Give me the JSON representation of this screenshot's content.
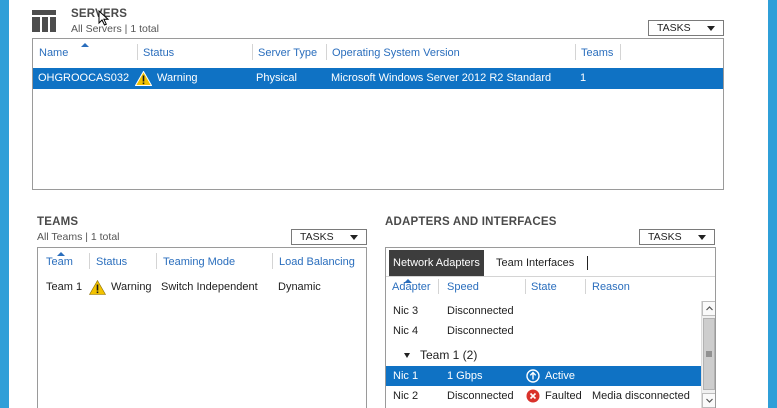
{
  "servers": {
    "title": "SERVERS",
    "subtitle": "All Servers | 1 total",
    "tasks_label": "TASKS",
    "columns": [
      "Name",
      "Status",
      "Server Type",
      "Operating System Version",
      "Teams"
    ],
    "rows": [
      {
        "name": "OHGROOCAS032",
        "status": "Warning",
        "server_type": "Physical",
        "os": "Microsoft Windows Server 2012 R2 Standard",
        "teams": "1"
      }
    ]
  },
  "teams": {
    "title": "TEAMS",
    "subtitle": "All Teams | 1 total",
    "tasks_label": "TASKS",
    "columns": [
      "Team",
      "Status",
      "Teaming Mode",
      "Load Balancing"
    ],
    "rows": [
      {
        "team": "Team 1",
        "status": "Warning",
        "mode": "Switch Independent",
        "load_balancing": "Dynamic"
      }
    ]
  },
  "adapters": {
    "title": "ADAPTERS AND INTERFACES",
    "tasks_label": "TASKS",
    "tabs": [
      "Network Adapters",
      "Team Interfaces"
    ],
    "columns": [
      "Adapter",
      "Speed",
      "State",
      "Reason"
    ],
    "rows": [
      {
        "adapter": "Nic 3",
        "speed": "Disconnected",
        "state": "",
        "reason": ""
      },
      {
        "adapter": "Nic 4",
        "speed": "Disconnected",
        "state": "",
        "reason": ""
      }
    ],
    "group_label": "Team 1 (2)",
    "group_rows": [
      {
        "adapter": "Nic 1",
        "speed": "1 Gbps",
        "state": "Active",
        "reason": ""
      },
      {
        "adapter": "Nic 2",
        "speed": "Disconnected",
        "state": "Faulted",
        "reason": "Media disconnected"
      }
    ]
  },
  "colors": {
    "accent_blue": "#0f72c4",
    "header_text": "#2a6ebd",
    "warning": "#f2c200",
    "error": "#d9322b",
    "frame": "#2f9fd8"
  }
}
